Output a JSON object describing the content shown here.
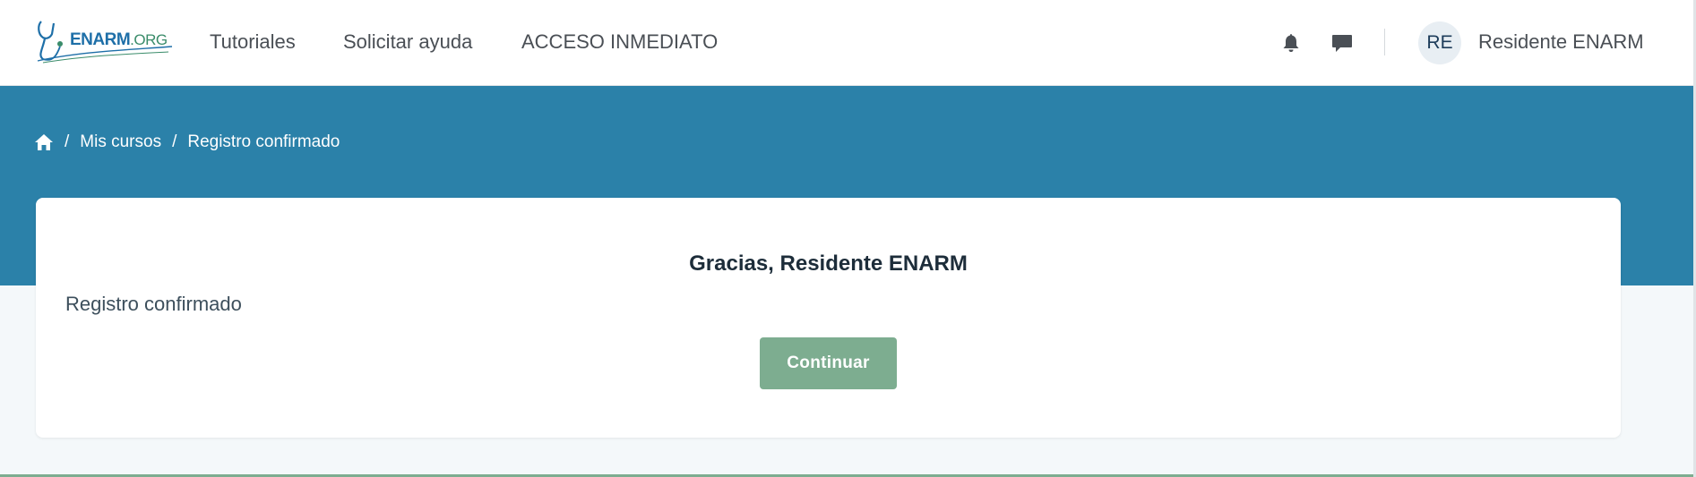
{
  "brand": {
    "logo_main": "ENARM",
    "logo_suffix": ".ORG"
  },
  "nav": {
    "links": [
      {
        "label": "Tutoriales"
      },
      {
        "label": "Solicitar ayuda"
      },
      {
        "label": "ACCESO INMEDIATO"
      }
    ],
    "icons": [
      "bell-icon",
      "chat-icon"
    ],
    "avatar_initials": "RE",
    "username": "Residente ENARM"
  },
  "breadcrumb": {
    "home_icon": "home-icon",
    "separator": "/",
    "items": [
      {
        "label": "Mis cursos"
      },
      {
        "label": "Registro confirmado"
      }
    ]
  },
  "card": {
    "title": "Gracias, Residente ENARM",
    "status": "Registro confirmado",
    "button_label": "Continuar"
  },
  "colors": {
    "header_band": "#2b81a9",
    "button": "#7dad90",
    "page_background": "#f4f8fa"
  }
}
